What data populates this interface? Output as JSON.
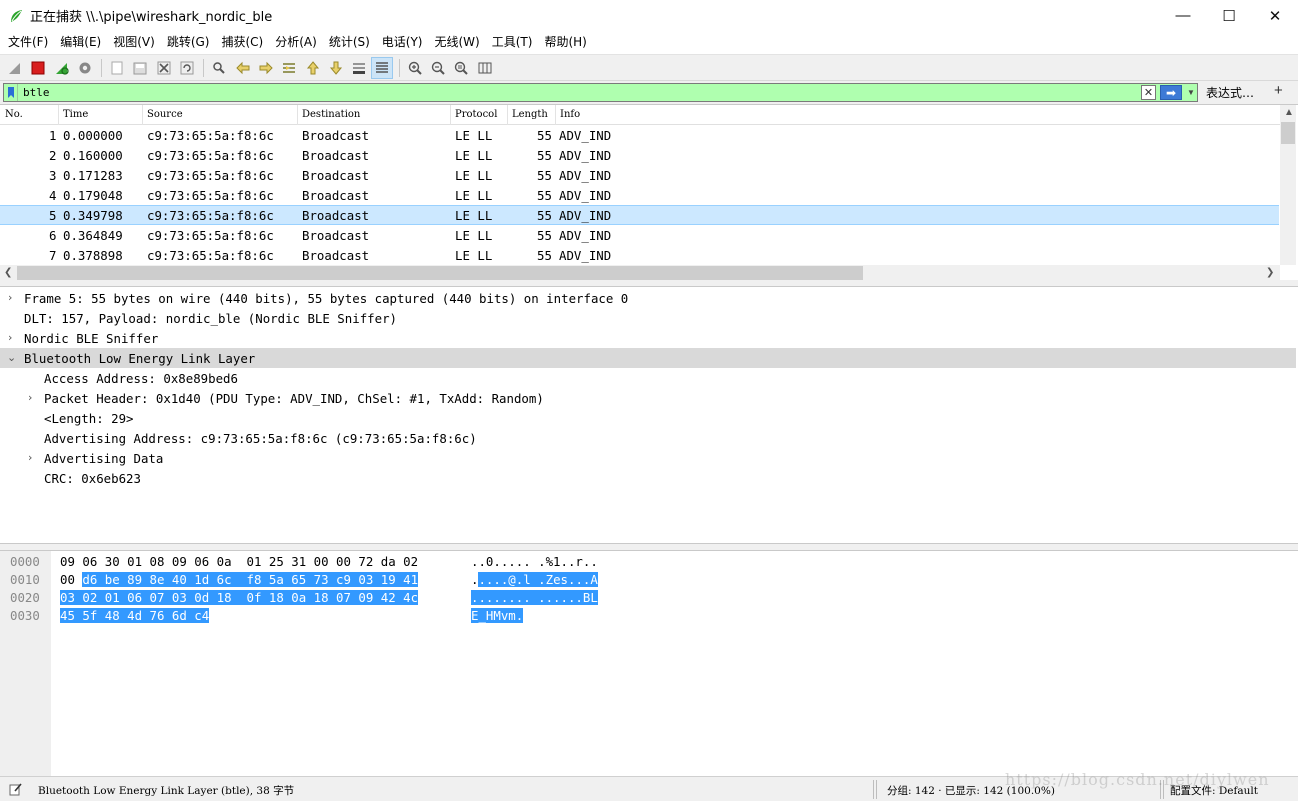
{
  "window": {
    "title": "正在捕获 \\\\.\\pipe\\wireshark_nordic_ble",
    "controls": {
      "minimize": "—",
      "maximize": "☐",
      "close": "✕"
    }
  },
  "menu": [
    "文件(F)",
    "编辑(E)",
    "视图(V)",
    "跳转(G)",
    "捕获(C)",
    "分析(A)",
    "统计(S)",
    "电话(Y)",
    "无线(W)",
    "工具(T)",
    "帮助(H)"
  ],
  "toolbar": {
    "icons": [
      "shark-fin-start-icon",
      "stop-capture-icon",
      "restart-capture-icon",
      "capture-options-icon",
      "open-file-icon",
      "save-file-icon",
      "close-file-icon",
      "reload-file-icon",
      "find-packet-icon",
      "go-back-icon",
      "go-forward-icon",
      "go-to-packet-icon",
      "first-packet-icon",
      "last-packet-icon",
      "autoscroll-icon",
      "colorize-icon",
      "zoom-in-icon",
      "zoom-out-icon",
      "normal-size-icon",
      "resize-columns-icon"
    ]
  },
  "filter": {
    "value": "btle",
    "expression_label": "表达式…",
    "add_label": "+",
    "color": "#afffaf"
  },
  "packet_list": {
    "columns": [
      "No.",
      "Time",
      "Source",
      "Destination",
      "Protocol",
      "Length",
      "Info"
    ],
    "rows": [
      {
        "no": "1",
        "time": "0.000000",
        "source": "c9:73:65:5a:f8:6c",
        "destination": "Broadcast",
        "protocol": "LE LL",
        "length": "55",
        "info": "ADV_IND"
      },
      {
        "no": "2",
        "time": "0.160000",
        "source": "c9:73:65:5a:f8:6c",
        "destination": "Broadcast",
        "protocol": "LE LL",
        "length": "55",
        "info": "ADV_IND"
      },
      {
        "no": "3",
        "time": "0.171283",
        "source": "c9:73:65:5a:f8:6c",
        "destination": "Broadcast",
        "protocol": "LE LL",
        "length": "55",
        "info": "ADV_IND"
      },
      {
        "no": "4",
        "time": "0.179048",
        "source": "c9:73:65:5a:f8:6c",
        "destination": "Broadcast",
        "protocol": "LE LL",
        "length": "55",
        "info": "ADV_IND"
      },
      {
        "no": "5",
        "time": "0.349798",
        "source": "c9:73:65:5a:f8:6c",
        "destination": "Broadcast",
        "protocol": "LE LL",
        "length": "55",
        "info": "ADV_IND"
      },
      {
        "no": "6",
        "time": "0.364849",
        "source": "c9:73:65:5a:f8:6c",
        "destination": "Broadcast",
        "protocol": "LE LL",
        "length": "55",
        "info": "ADV_IND"
      },
      {
        "no": "7",
        "time": "0.378898",
        "source": "c9:73:65:5a:f8:6c",
        "destination": "Broadcast",
        "protocol": "LE LL",
        "length": "55",
        "info": "ADV_IND"
      }
    ],
    "selected_row": 5
  },
  "details": [
    {
      "toggle": ">",
      "text": "Frame 5: 55 bytes on wire (440 bits), 55 bytes captured (440 bits) on interface 0"
    },
    {
      "toggle": "",
      "text": "DLT: 157, Payload: nordic_ble (Nordic BLE Sniffer)"
    },
    {
      "toggle": ">",
      "text": "Nordic BLE Sniffer"
    },
    {
      "toggle": "v",
      "text": "Bluetooth Low Energy Link Layer"
    },
    {
      "toggle": "",
      "text": "Access Address: 0x8e89bed6"
    },
    {
      "toggle": ">",
      "text": "Packet Header: 0x1d40 (PDU Type: ADV_IND, ChSel: #1, TxAdd: Random)"
    },
    {
      "toggle": "",
      "text": "<Length: 29>"
    },
    {
      "toggle": "",
      "text": "Advertising Address: c9:73:65:5a:f8:6c (c9:73:65:5a:f8:6c)"
    },
    {
      "toggle": ">",
      "text": "Advertising Data"
    },
    {
      "toggle": "",
      "text": "CRC: 0x6eb623"
    }
  ],
  "bytes": [
    {
      "offset": "0000",
      "hex_plain": "09 06 30 01 08 09 06 0a  01 25 31 00 00 72 da 02",
      "hex_sel": "",
      "ascii_plain": "..0..... .%1..r..",
      "ascii_sel": ""
    },
    {
      "offset": "0010",
      "hex_plain": "00 ",
      "hex_sel": "d6 be 89 8e 40 1d 6c  f8 5a 65 73 c9 03 19 41",
      "ascii_plain": ".",
      "ascii_sel": "....@.l .Zes...A"
    },
    {
      "offset": "0020",
      "hex_plain": "",
      "hex_sel": "03 02 01 06 07 03 0d 18  0f 18 0a 18 07 09 42 4c",
      "ascii_plain": "",
      "ascii_sel": "........ ......BL"
    },
    {
      "offset": "0030",
      "hex_plain": "",
      "hex_sel": "45 5f 48 4d 76 6d c4",
      "ascii_plain": "",
      "ascii_sel": "E_HMvm."
    }
  ],
  "status": {
    "left": "Bluetooth Low Energy Link Layer (btle), 38 字节",
    "middle": "分组: 142 · 已显示: 142 (100.0%)",
    "right": "配置文件: Default"
  },
  "watermark": "https://blog.csdn.net/diylwen"
}
